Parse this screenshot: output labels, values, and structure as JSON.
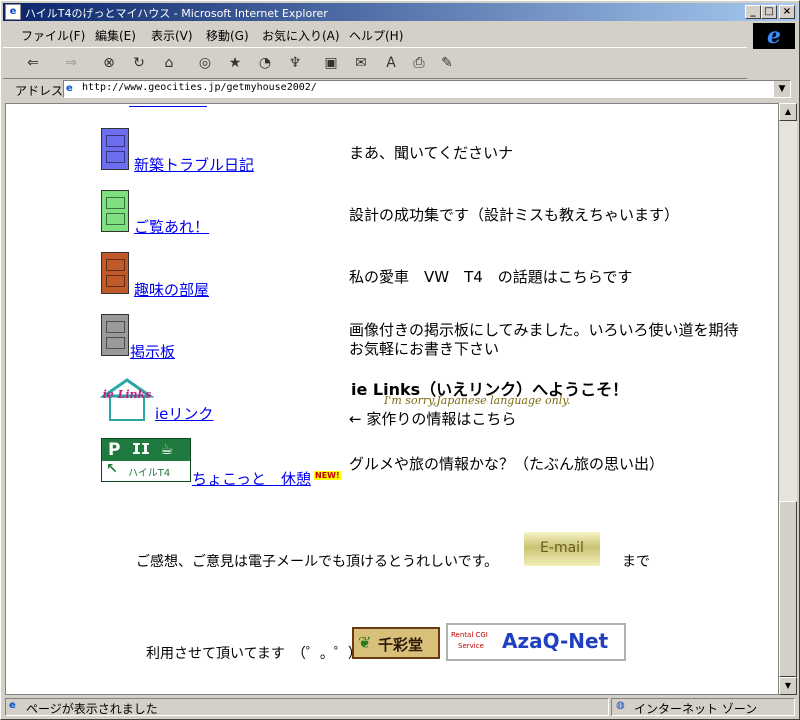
{
  "window": {
    "title": "ハイルT4のげっとマイハウス - Microsoft Internet Explorer"
  },
  "menu": [
    "ファイル(F)",
    "編集(E)",
    "表示(V)",
    "移動(G)",
    "お気に入り(A)",
    "ヘルプ(H)"
  ],
  "address": {
    "label": "アドレス",
    "url": "http://www.geocities.jp/getmyhouse2002/"
  },
  "content": {
    "rows": [
      {
        "link": "新築トラブル日記",
        "desc": "まあ、聞いてくださいナ",
        "door_color": "#6d6df0"
      },
      {
        "link": "ご覧あれ！",
        "desc": "設計の成功集です（設計ミスも教えちゃいます）",
        "door_color": "#7fe07f"
      },
      {
        "link": "趣味の部屋",
        "desc": "私の愛車　VW　T4　の話題はこちらです",
        "door_color": "#c05a2a"
      },
      {
        "link": "掲示板",
        "desc1": "画像付きの掲示板にしてみました。いろいろ使い道を期待",
        "desc2": "お気軽にお書き下さい",
        "door_color": "#9a9a9a"
      }
    ],
    "ie_row": {
      "link": "ieリンク",
      "icon_text": "ie Links",
      "title": "ie Links（いえリンク）へようこそ！",
      "subtitle": "I'm sorry,Japanese language only.",
      "desc": "← 家作りの情報はこちら"
    },
    "rest_row": {
      "link": "ちょこっと　休憩",
      "new_badge": "NEW!",
      "sign_label": "ハイルT4",
      "desc": "グルメや旅の情報かな？（たぶん旅の思い出）"
    },
    "contact": {
      "text": "ご感想、ご意見は電子メールでも頂けるとうれしいです。",
      "button": "E-mail",
      "suffix": "まで"
    },
    "credits": {
      "text": "利用させて頂いてます　（゜。゜）",
      "badge1": "千彩堂",
      "badge2_small1": "Rental CGI",
      "badge2_small2": "Service",
      "badge2_big": "AzaQ-Net"
    }
  },
  "status": {
    "left": "ページが表示されました",
    "right": "インターネット ゾーン"
  },
  "colors": {
    "link": "#0000ee",
    "titlebar_start": "#0a246a",
    "titlebar_end": "#a6caf0"
  }
}
